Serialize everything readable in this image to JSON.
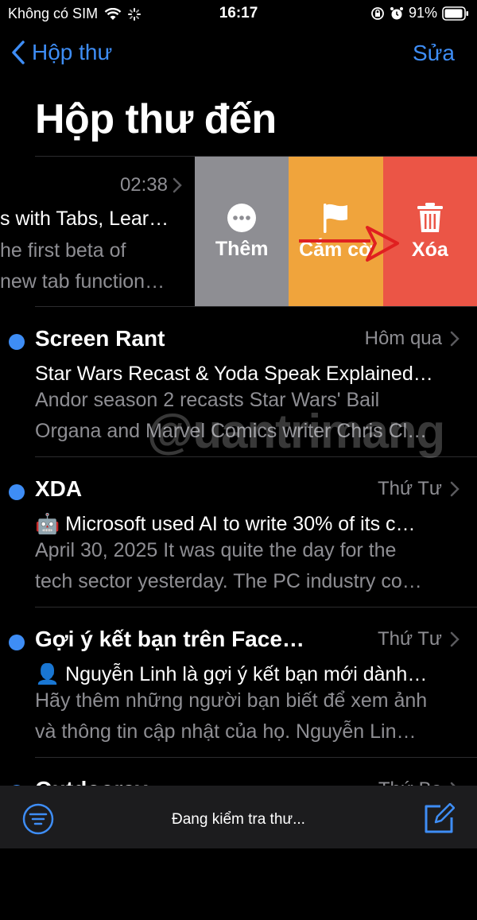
{
  "status_bar": {
    "carrier": "Không có SIM",
    "time": "16:17",
    "battery": "91%"
  },
  "nav": {
    "back_label": "Hộp thư",
    "edit_label": "Sửa"
  },
  "title": "Hộp thư đến",
  "swiped_mail": {
    "time": "02:38",
    "subject": "s with Tabs, Lear…",
    "preview_1": "he first beta of",
    "preview_2": "new tab function…"
  },
  "actions": {
    "more": "Thêm",
    "flag": "Cắm cờ",
    "delete": "Xóa"
  },
  "mails": [
    {
      "sender": "Screen Rant",
      "date": "Hôm qua",
      "subject": "Star Wars Recast & Yoda Speak Explained…",
      "preview_1": "Andor season 2 recasts Star Wars' Bail",
      "preview_2": "Organa and Marvel Comics writer Chris Cl…"
    },
    {
      "sender": "XDA",
      "date": "Thứ Tư",
      "subject": "🤖 Microsoft used AI to write 30% of its c…",
      "preview_1": "April 30, 2025 It was quite the day for the",
      "preview_2": "tech sector yesterday. The PC industry co…"
    },
    {
      "sender": "Gợi ý kết bạn trên Face…",
      "date": "Thứ Tư",
      "subject": "👤 Nguyễn Linh là gợi ý kết bạn mới dành…",
      "preview_1": "Hãy thêm những người bạn biết để xem ảnh",
      "preview_2": "và thông tin cập nhật của họ. Nguyễn Lin…"
    },
    {
      "sender": "Outdoorsy",
      "date": "Thứ Ba"
    }
  ],
  "toolbar": {
    "status": "Đang kiểm tra thư..."
  },
  "watermark": "@uantrimang",
  "colors": {
    "accent": "#3e8df5",
    "more": "#8e8e93",
    "flag": "#f0a43c",
    "delete": "#eb5546"
  }
}
